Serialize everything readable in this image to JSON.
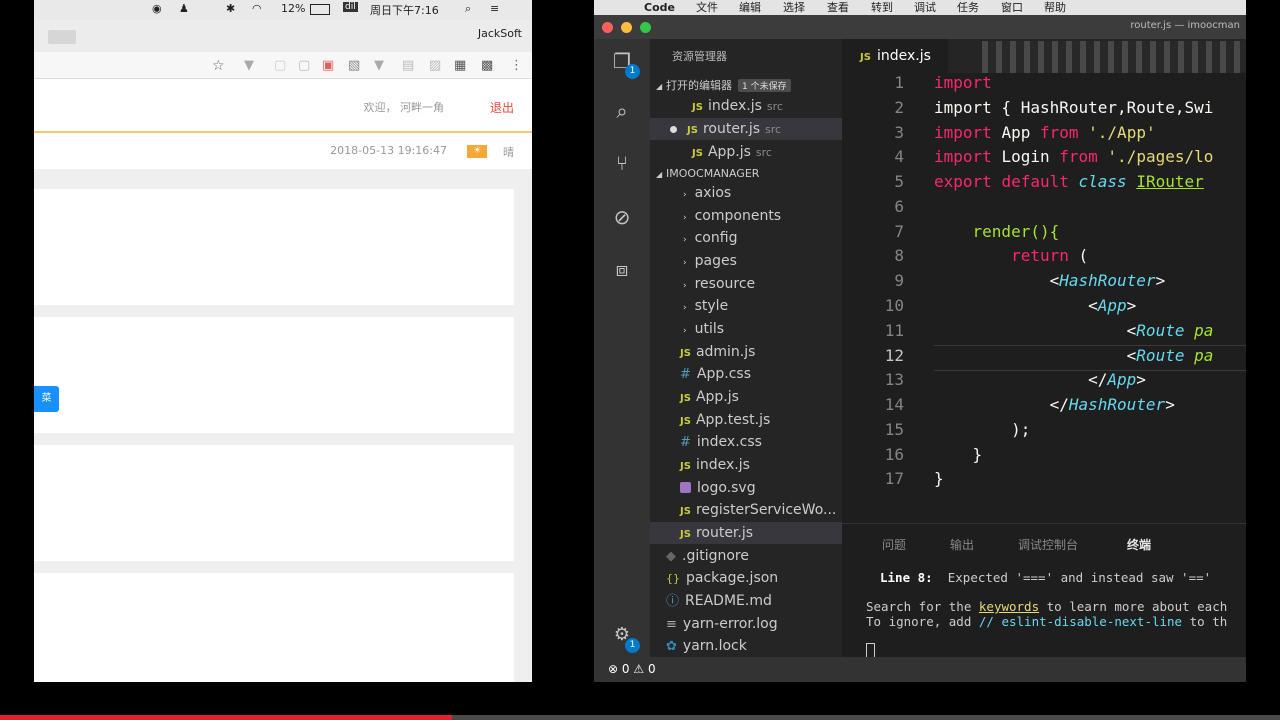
{
  "browser": {
    "status_battery": "12%",
    "status_clock": "周日下午7:16",
    "user": "JackSoft",
    "header": {
      "welcome": "欢迎，",
      "username": "河畔一角",
      "logout": "退出"
    },
    "datetime": "2018-05-13 19:16:47",
    "weather": "晴",
    "side_button_label": "菜"
  },
  "vscode": {
    "menu": [
      "Code",
      "文件",
      "编辑",
      "选择",
      "查看",
      "转到",
      "调试",
      "任务",
      "窗口",
      "帮助"
    ],
    "window_title": "router.js — imoocman",
    "explorer_title": "资源管理器",
    "open_editors": {
      "title": "打开的编辑器",
      "badge": "1 个未保存",
      "items": [
        {
          "name": "index.js",
          "path": "src"
        },
        {
          "name": "router.js",
          "path": "src"
        },
        {
          "name": "App.js",
          "path": "src"
        }
      ]
    },
    "project": {
      "title": "IMOOCMANAGER",
      "folders": [
        "axios",
        "components",
        "config",
        "pages",
        "resource",
        "style",
        "utils"
      ],
      "src_files": [
        {
          "name": "admin.js",
          "icon": "js-icon"
        },
        {
          "name": "App.css",
          "icon": "css-icon"
        },
        {
          "name": "App.js",
          "icon": "js-icon"
        },
        {
          "name": "App.test.js",
          "icon": "js-icon"
        },
        {
          "name": "index.css",
          "icon": "css-icon"
        },
        {
          "name": "index.js",
          "icon": "js-icon"
        },
        {
          "name": "logo.svg",
          "icon": "svg-icon"
        },
        {
          "name": "registerServiceWo...",
          "icon": "js-icon"
        },
        {
          "name": "router.js",
          "icon": "js-icon"
        }
      ],
      "root_files": [
        {
          "name": ".gitignore",
          "icon": "git-icon"
        },
        {
          "name": "package.json",
          "icon": "json-icon"
        },
        {
          "name": "README.md",
          "icon": "info-icon"
        },
        {
          "name": "yarn-error.log",
          "icon": "log-icon"
        },
        {
          "name": "yarn.lock",
          "icon": "yarn-icon"
        }
      ]
    },
    "active_tab": "index.js",
    "line_numbers": [
      "1",
      "2",
      "3",
      "4",
      "5",
      "6",
      "7",
      "8",
      "9",
      "10",
      "11",
      "12",
      "13",
      "14",
      "15",
      "16",
      "17"
    ],
    "current_line": "12",
    "code": {
      "l1": "import",
      "l2": "import { HashRouter,Route,Swi",
      "l3_kw": "import",
      "l3_id": "App",
      "l3_from": "from",
      "l3_str": "'./App'",
      "l4_kw": "import",
      "l4_id": "Login",
      "l4_from": "from",
      "l4_str": "'./pages/lo",
      "l5_kw1": "export",
      "l5_kw2": "default",
      "l5_kw3": "class",
      "l5_cls": "IRouter",
      "l7": "render(){",
      "l8_kw": "return",
      "l8_paren": "(",
      "l9": "HashRouter",
      "l10": "App",
      "l11": "Route",
      "l11_attr": "pa",
      "l12": "Route",
      "l12_attr": "pa",
      "l13": "App",
      "l14": "HashRouter",
      "l15": ");",
      "l16": "}",
      "l17": "}"
    },
    "panel": {
      "tabs": [
        "问题",
        "输出",
        "调试控制台",
        "终端"
      ],
      "line8_label": "Line 8:",
      "line8_msg": "Expected '===' and instead saw '=='",
      "search_pre": "Search for the ",
      "search_link": "keywords",
      "search_post": " to learn more about each",
      "ignore_pre": "To ignore, add ",
      "ignore_cmt": "// eslint-disable-next-line",
      "ignore_post": " to th"
    },
    "status": {
      "errors": "0",
      "warnings": "0"
    },
    "explorer_badge": "1",
    "settings_badge": "1"
  },
  "video": {
    "progress_fraction": 0.353
  }
}
